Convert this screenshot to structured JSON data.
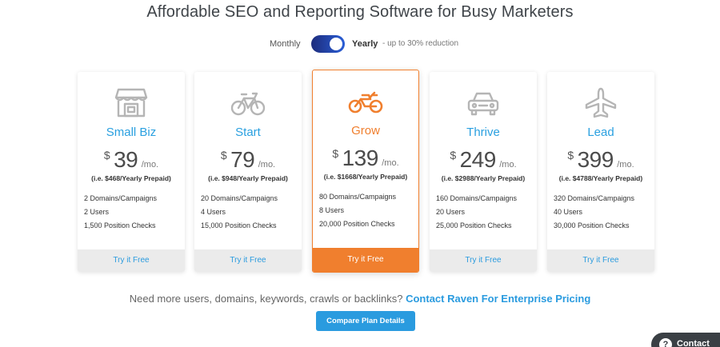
{
  "headline": "Affordable SEO and Reporting Software for Busy Marketers",
  "billing_toggle": {
    "monthly_label": "Monthly",
    "yearly_label": "Yearly",
    "reduction_text": "- up to 30% reduction",
    "selected": "Yearly"
  },
  "plans": [
    {
      "name": "Small Biz",
      "icon": "storefront-icon",
      "currency": "$",
      "price": "39",
      "period": "/mo.",
      "prepaid": "(i.e. $468/Yearly Prepaid)",
      "features": [
        "2 Domains/Campaigns",
        "2 Users",
        "1,500 Position Checks"
      ],
      "cta": "Try it Free"
    },
    {
      "name": "Start",
      "icon": "bicycle-icon",
      "currency": "$",
      "price": "79",
      "period": "/mo.",
      "prepaid": "(i.e. $948/Yearly Prepaid)",
      "features": [
        "20 Domains/Campaigns",
        "4 Users",
        "15,000 Position Checks"
      ],
      "cta": "Try it Free"
    },
    {
      "name": "Grow",
      "icon": "motorcycle-icon",
      "currency": "$",
      "price": "139",
      "period": "/mo.",
      "prepaid": "(i.e. $1668/Yearly Prepaid)",
      "features": [
        "80 Domains/Campaigns",
        "8 Users",
        "20,000 Position Checks"
      ],
      "cta": "Try it Free",
      "featured": true
    },
    {
      "name": "Thrive",
      "icon": "car-icon",
      "currency": "$",
      "price": "249",
      "period": "/mo.",
      "prepaid": "(i.e. $2988/Yearly Prepaid)",
      "features": [
        "160 Domains/Campaigns",
        "20 Users",
        "25,000 Position Checks"
      ],
      "cta": "Try it Free"
    },
    {
      "name": "Lead",
      "icon": "airplane-icon",
      "currency": "$",
      "price": "399",
      "period": "/mo.",
      "prepaid": "(i.e. $4788/Yearly Prepaid)",
      "features": [
        "320 Domains/Campaigns",
        "40 Users",
        "30,000 Position Checks"
      ],
      "cta": "Try it Free"
    }
  ],
  "enterprise": {
    "question": "Need more users, domains, keywords, crawls or backlinks?",
    "link": "Contact Raven For Enterprise Pricing"
  },
  "compare_button": "Compare Plan Details",
  "contact_widget": {
    "label": "Contact",
    "icon": "question-icon"
  },
  "colors": {
    "accent_blue": "#2a9bdf",
    "featured_orange": "#f07f2e",
    "icon_gray": "#b5b5b5"
  }
}
